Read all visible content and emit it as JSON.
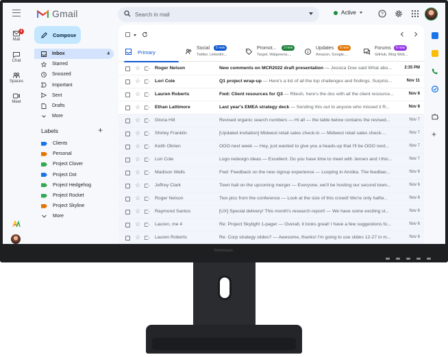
{
  "app": {
    "name": "Gmail"
  },
  "search": {
    "placeholder": "Search in mail"
  },
  "status": {
    "label": "Active",
    "color": "#1e8e3e"
  },
  "rail": [
    {
      "label": "Mail",
      "badge": "4",
      "icon": "mail-icon"
    },
    {
      "label": "Chat",
      "icon": "chat-icon"
    },
    {
      "label": "Spaces",
      "icon": "spaces-icon"
    },
    {
      "label": "Meet",
      "icon": "meet-icon"
    }
  ],
  "compose": {
    "label": "Compose"
  },
  "nav": [
    {
      "label": "Inbox",
      "count": "4",
      "icon": "inbox-icon"
    },
    {
      "label": "Starred",
      "icon": "star-icon"
    },
    {
      "label": "Snoozed",
      "icon": "clock-icon"
    },
    {
      "label": "Important",
      "icon": "important-icon"
    },
    {
      "label": "Sent",
      "icon": "send-icon"
    },
    {
      "label": "Drafts",
      "icon": "draft-icon"
    },
    {
      "label": "More",
      "icon": "chevron-down-icon"
    }
  ],
  "labels": {
    "title": "Labels",
    "items": [
      {
        "label": "Clients",
        "color": "#1a73e8"
      },
      {
        "label": "Personal",
        "color": "#e37400"
      },
      {
        "label": "Project Clover",
        "color": "#34a853"
      },
      {
        "label": "Project Dot",
        "color": "#1a73e8"
      },
      {
        "label": "Project Hedgehog",
        "color": "#34a853"
      },
      {
        "label": "Project Rocket",
        "color": "#34a853"
      },
      {
        "label": "Project Skyline",
        "color": "#e37400"
      }
    ],
    "more": "More"
  },
  "tabs": [
    {
      "title": "Primary",
      "sub": "",
      "badge": ""
    },
    {
      "title": "Social",
      "sub": "Twitter, LinkedIn...",
      "badge": "5 new",
      "badge_color": "#0b57d0"
    },
    {
      "title": "Promot...",
      "sub": "Target, Walgreens,...",
      "badge": "3 new",
      "badge_color": "#188038"
    },
    {
      "title": "Updates",
      "sub": "Amazon, Google,...",
      "badge": "8 new",
      "badge_color": "#e37400"
    },
    {
      "title": "Forums",
      "sub": "GitHub, Blog Web...",
      "badge": "6 new",
      "badge_color": "#9334e6"
    }
  ],
  "emails": [
    {
      "sender": "Roger Nelson",
      "subject": "New comments on MCR2022 draft presentation",
      "snippet": " — Jessica Dow said What abo...",
      "date": "2:35 PM",
      "unread": true
    },
    {
      "sender": "Lori Cole",
      "subject": "Q1 project wrap-up",
      "snippet": " — Here's a list of all the top challenges and findings. Surprisi...",
      "date": "Nov 11",
      "unread": true
    },
    {
      "sender": "Lauren Roberts",
      "subject": "Fwd: Client resources for Q3",
      "snippet": " — Ritesh, here's the doc with all the client resource...",
      "date": "Nov 8",
      "unread": true
    },
    {
      "sender": "Ethan Lattimore",
      "subject": "Last year's EMEA strategy deck",
      "snippet": " — Sending this out to anyone who missed it R...",
      "date": "Nov 8",
      "unread": true
    },
    {
      "sender": "Gloria Hill",
      "subject": "Revised organic search numbers",
      "snippet": " — Hi all — the table below contains the revised...",
      "date": "Nov 7",
      "unread": false
    },
    {
      "sender": "Shirley Franklin",
      "subject": "[Updated invitation] Midwest retail sales check-in",
      "snippet": " — Midwest retail sales check-...",
      "date": "Nov 7",
      "unread": false
    },
    {
      "sender": "Keith Obrien",
      "subject": "OOO next week",
      "snippet": " — Hey, just wanted to give you a heads-up that I'll be OOO next...",
      "date": "Nov 7",
      "unread": false
    },
    {
      "sender": "Lori Cole",
      "subject": "Logo redesign ideas",
      "snippet": " — Excellent. Do you have time to meet with Jeroen and I this...",
      "date": "Nov 7",
      "unread": false
    },
    {
      "sender": "Madison Wells",
      "subject": "Fwd: Feedback on the new signup experience",
      "snippet": " — Looping in Annika. The feedbac...",
      "date": "Nov 6",
      "unread": false
    },
    {
      "sender": "Jeffrey Clark",
      "subject": "Town hall on the upcoming merger",
      "snippet": " — Everyone, we'll be hosting our second town...",
      "date": "Nov 6",
      "unread": false
    },
    {
      "sender": "Roger Nelson",
      "subject": "Two pics from the conference",
      "snippet": " — Look at the size of this crowd! We're only halfw...",
      "date": "Nov 6",
      "unread": false
    },
    {
      "sender": "Raymond Santos",
      "subject": "[UX] Special delivery! This month's research report!",
      "snippet": " — We have some exciting st...",
      "date": "Nov 6",
      "unread": false
    },
    {
      "sender": "Lauren, me 4",
      "subject": "Re: Project Skylight 1-pager",
      "snippet": " — Overall, it looks great! I have a few suggestions fo...",
      "date": "Nov 6",
      "unread": false
    },
    {
      "sender": "Lauren Roberts",
      "subject": "Re: Corp strategy slides?",
      "snippet": " — Awesome, thanks! I'm going to use slides 12-27 in m...",
      "date": "Nov 6",
      "unread": false
    }
  ],
  "monitor": {
    "brand": "ThinkVision"
  }
}
